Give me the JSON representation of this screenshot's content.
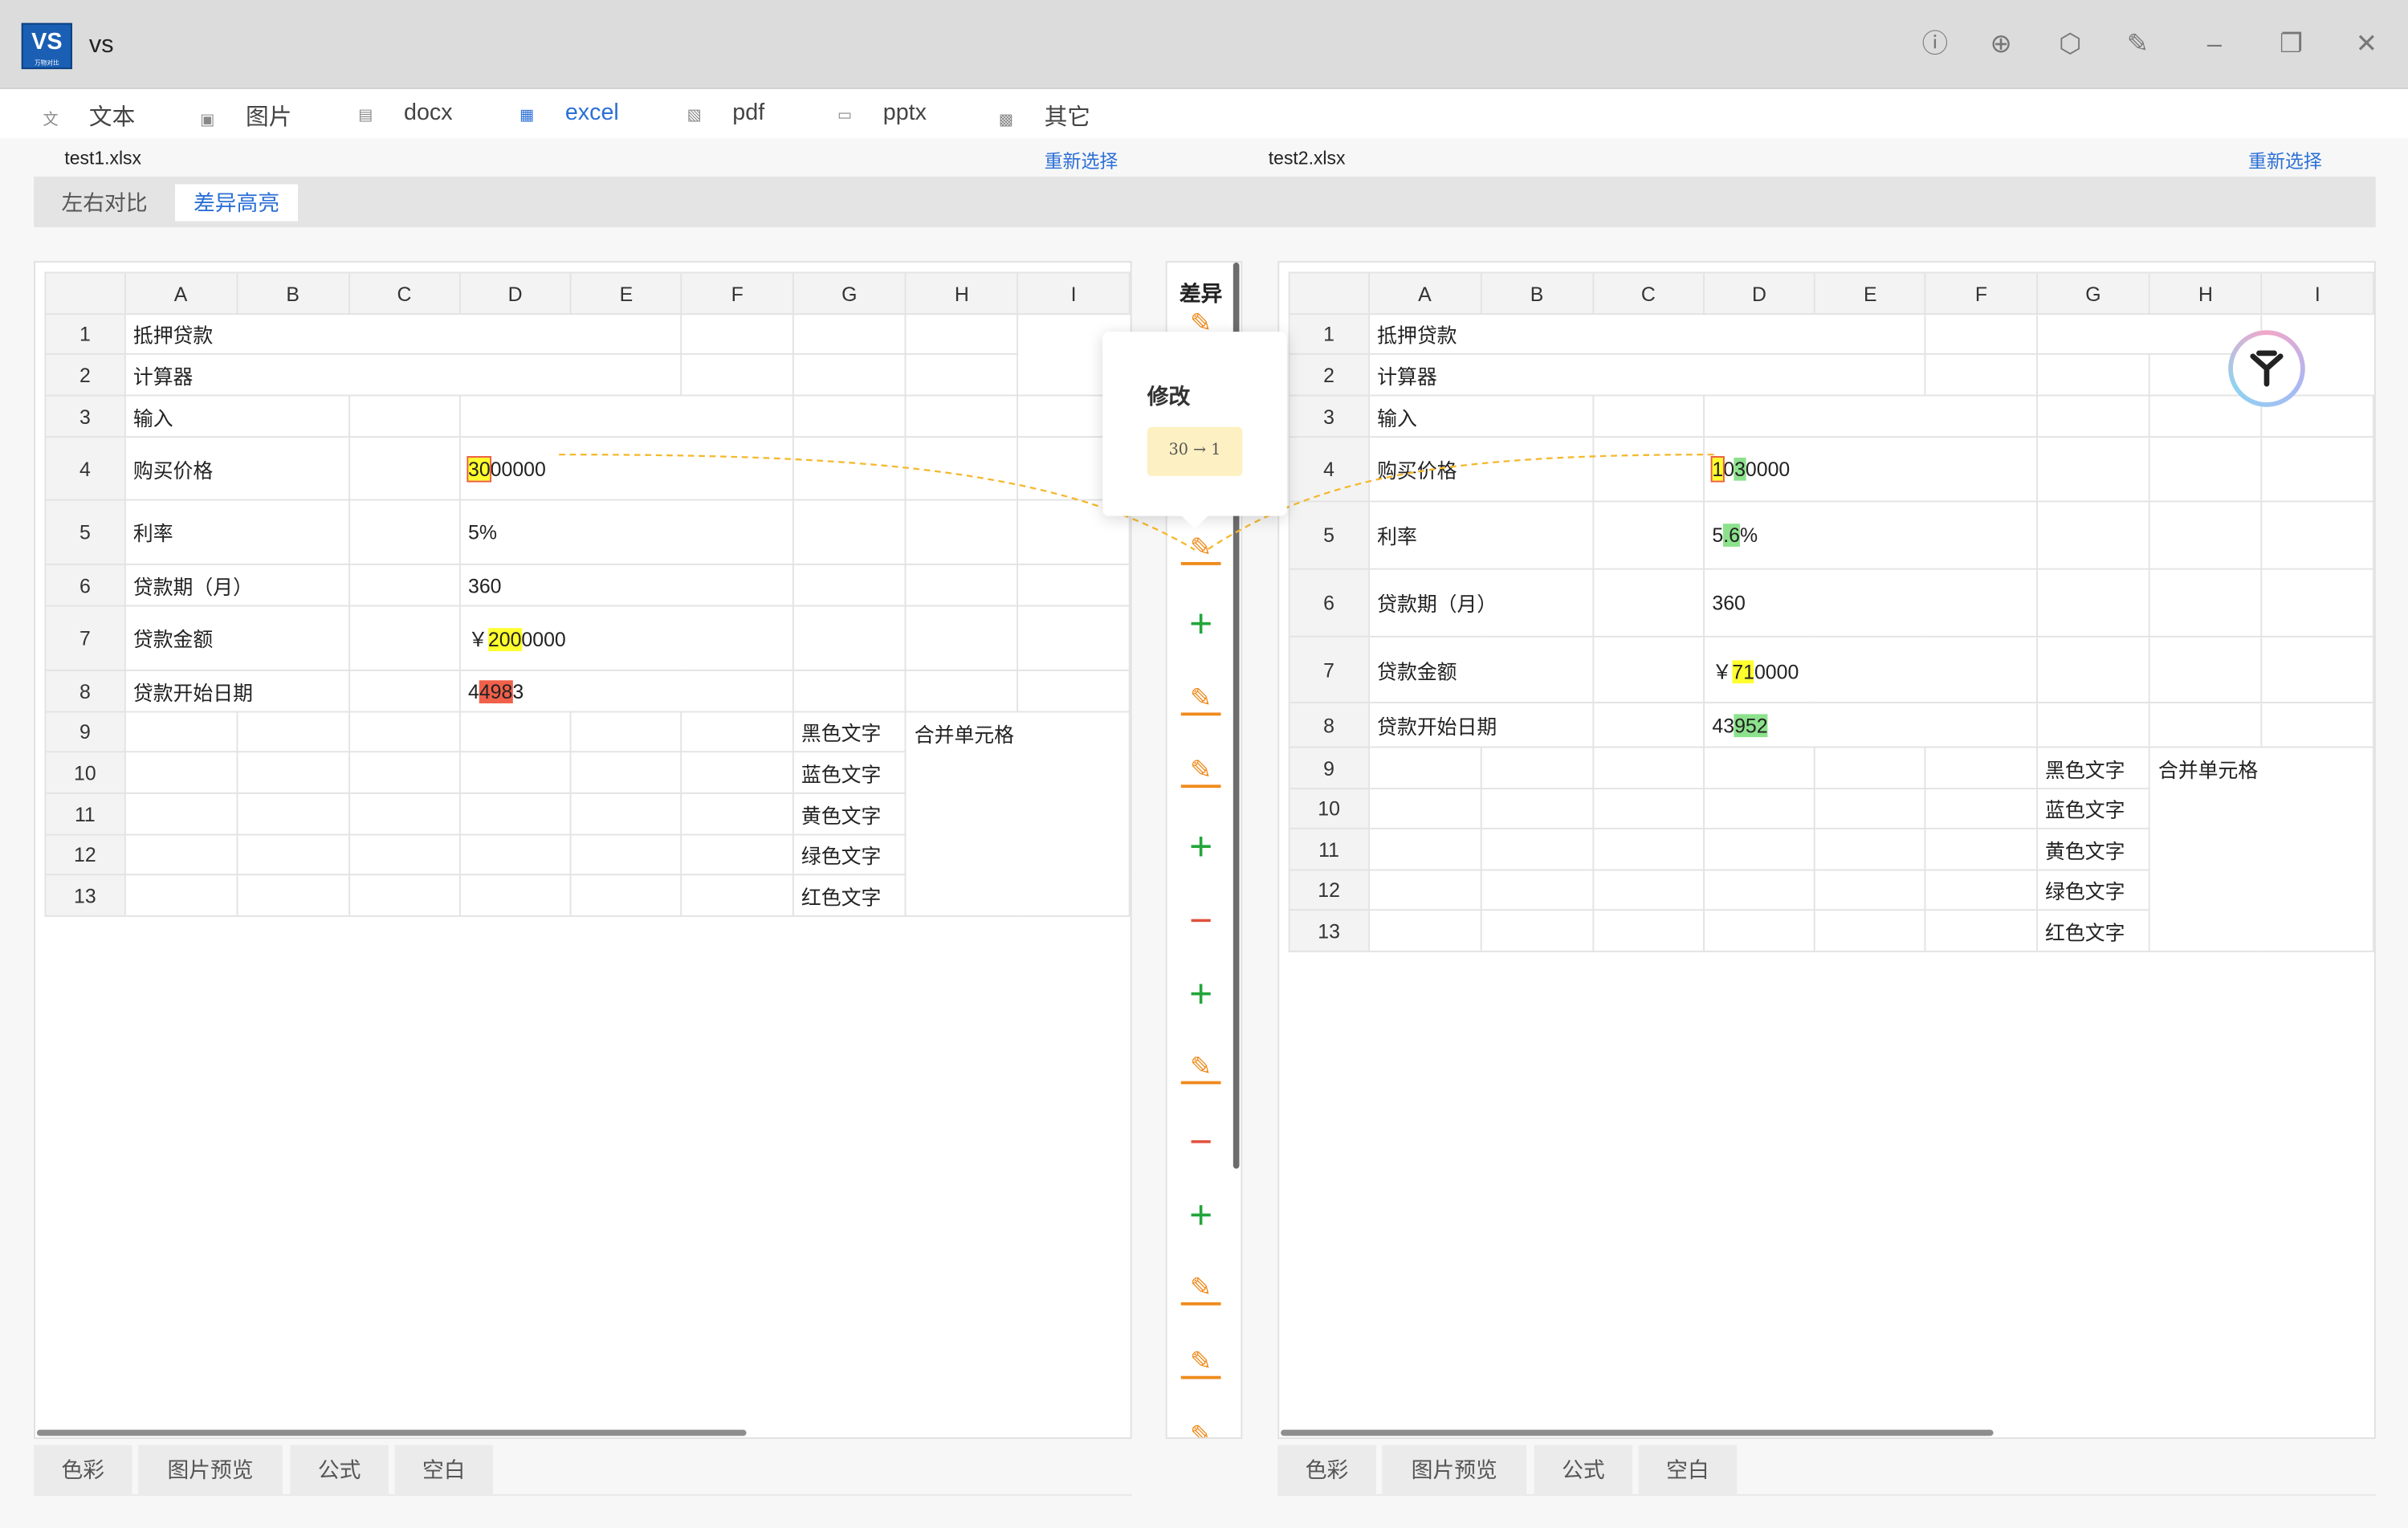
{
  "app": {
    "logo_text": "VS",
    "logo_sub": "万物对比",
    "title": "vs"
  },
  "titlebar_icons": [
    "info-icon",
    "zoom-in-icon",
    "settings-icon",
    "pin-icon",
    "minimize-icon",
    "restore-icon",
    "close-icon"
  ],
  "nav": [
    {
      "label": "文本",
      "icon": "translate-icon",
      "name": "text"
    },
    {
      "label": "图片",
      "icon": "image-icon",
      "name": "image"
    },
    {
      "label": "docx",
      "icon": "doc-icon",
      "name": "docx"
    },
    {
      "label": "excel",
      "icon": "table-icon",
      "name": "excel",
      "active": true
    },
    {
      "label": "pdf",
      "icon": "pdf-icon",
      "name": "pdf"
    },
    {
      "label": "pptx",
      "icon": "slides-icon",
      "name": "pptx"
    },
    {
      "label": "其它",
      "icon": "grid-icon",
      "name": "other"
    }
  ],
  "files": {
    "left": "test1.xlsx",
    "right": "test2.xlsx",
    "reselect": "重新选择"
  },
  "modes": {
    "side_by_side": "左右对比",
    "highlight": "差异高亮"
  },
  "columns": [
    "A",
    "B",
    "C",
    "D",
    "E",
    "F",
    "G",
    "H",
    "I"
  ],
  "left": {
    "rows": [
      "1",
      "2",
      "3",
      "4",
      "5",
      "6",
      "7",
      "8",
      "9",
      "10",
      "11",
      "12",
      "13"
    ],
    "r1": "抵押贷款",
    "r2": "计算器",
    "r3": "输入",
    "r4": "购买价格",
    "r4v": {
      "a": "30",
      "b": "0",
      "c": "0000"
    },
    "r5": "利率",
    "r5v": "5%",
    "r6": "贷款期（月）",
    "r6v": "360",
    "r7": "贷款金额",
    "r7v": {
      "a": "￥",
      "b": "200",
      "c": "0000"
    },
    "r8": "贷款开始日期",
    "r8v": {
      "a": "4",
      "b": "498",
      "c": "3"
    }
  },
  "right": {
    "r1": "抵押贷款",
    "r2": "计算器",
    "r3": "输入",
    "r4": "购买价格",
    "r4v": {
      "a": "1",
      "b": "0",
      "c": "3",
      "d": "0000"
    },
    "r5": "利率",
    "r5v": {
      "a": "5",
      "b": ".6",
      "c": "%"
    },
    "r6": "贷款期（月）",
    "r6v": "360",
    "r7": "贷款金额",
    "r7v": {
      "a": "￥",
      "b": "71",
      "c": "0000"
    },
    "r8": "贷款开始日期",
    "r8v": {
      "a": "4",
      "b": "3",
      "c": "952"
    }
  },
  "colors_col": [
    "黑色文字",
    "蓝色文字",
    "黄色文字",
    "绿色文字",
    "红色文字"
  ],
  "merged": "合并单元格",
  "diff": {
    "header": "差异",
    "items": [
      "mod",
      "mod",
      "add",
      "mod",
      "mod",
      "add",
      "del",
      "add",
      "mod",
      "del",
      "add",
      "mod",
      "mod",
      "mod"
    ]
  },
  "popup": {
    "title": "修改",
    "from": "30",
    "arrow": "→",
    "to": "1"
  },
  "bottom_tabs": [
    "色彩",
    "图片预览",
    "公式",
    "空白"
  ],
  "colors": {
    "accent": "#2b6fd6",
    "modify": "#f08a1c",
    "add": "#22a63a",
    "delete": "#e0503c",
    "highlight_yellow": "#ffff2e",
    "highlight_red": "#f0604a",
    "highlight_green": "#8ce28c"
  }
}
